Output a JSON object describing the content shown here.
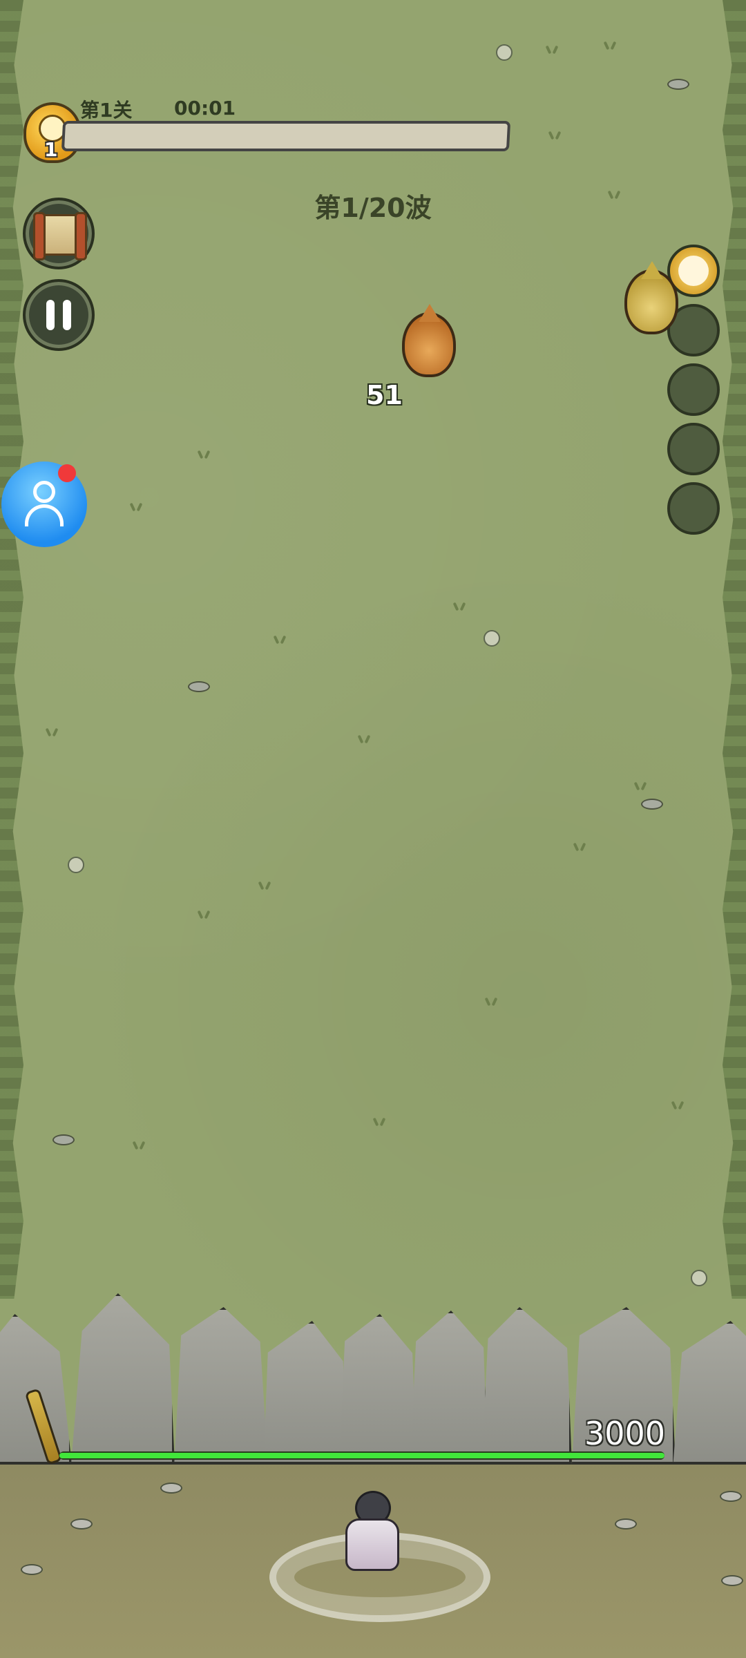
{
  "hud": {
    "level_badge_number": "1",
    "level_title": "第1关",
    "timer": "00:01",
    "stage_progress": 0.0
  },
  "wave": {
    "label": "第1/20波"
  },
  "buttons": {
    "map_scroll": "scroll-icon",
    "pause": "pause-icon",
    "profile": "user-icon"
  },
  "profile_notification": true,
  "skills": {
    "slots": [
      "bird-icon",
      "",
      "",
      "",
      ""
    ]
  },
  "battlefield": {
    "damage_number": "51",
    "enemies": [
      "orange-enemy",
      "yellow-enemy"
    ]
  },
  "wall": {
    "hp": "3000",
    "hp_fraction": 1.0
  },
  "colors": {
    "grass": "#94a46f",
    "hp_green": "#41e63a",
    "profile_blue": "#1f8cf0",
    "notification_red": "#f0393a"
  }
}
